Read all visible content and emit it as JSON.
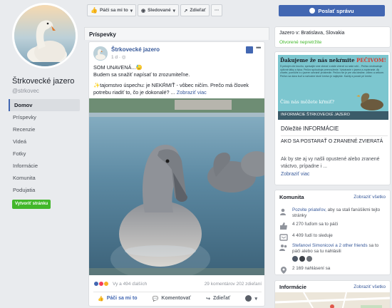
{
  "page": {
    "name": "Štrkovecké jazero",
    "handle": "@strkovec"
  },
  "left_nav": {
    "items": [
      "Domov",
      "Príspevky",
      "Recenzie",
      "Videá",
      "Fotky",
      "Informácie",
      "Komunita",
      "Podujatia"
    ],
    "create_store": "Vytvoriť stránku"
  },
  "topbar": {
    "like": "Páči sa mi to",
    "follow": "Sledované",
    "share": "Zdieľať",
    "more": "···",
    "send_message": "Poslať správu"
  },
  "posts": {
    "header": "Príspevky"
  },
  "post": {
    "author": "Štrkovecké jazero",
    "time": "1 d",
    "text_line1": "SOM UNAVENÁ...😓",
    "text_line2": "Budem sa snažiť napísať to zrozumiteľne.",
    "text_line3": "✨tajomstvo úspechu: je NEKŔMIŤ - vôbec ničím. Prečo má človek potrebu riadiť to, čo je dokonalé? ...",
    "see_more": "Zobraziť viac",
    "reaction_count": "Vy a 494 ďalších",
    "reaction_stats": "29 komentárov  202 zdieľaní",
    "actions": [
      "Páči sa mi to",
      "Komentovať",
      "Zdieľať"
    ]
  },
  "about": {
    "location": "Jazero v: Bratislava, Slovakia",
    "open": "Otvorené nepretržite"
  },
  "info_card": {
    "banner_title_prefix": "Ďakujeme že nás nekŕmite",
    "banner_title_emph": "PEČIVOM!",
    "banner_text": "S pekným dní kruchu, správajte sme zberať a stále zberať sú naše srbi... Pečivo neobsahuje výživné látky a býva. Pečivo spôsobuje premnoženie. Vytváranie v jazera a zopieranie. Ak chcete, pomôžte a v jazere ochrániť prostredie. Pečivo nie je pre vás ideálne, vôbec a celkom. Pečivo sa dáva buď a rozhodne ktoré krmivo je najlepšie. Každý a poradí pri krmiví.",
    "banner_question": "Čím nás môžete kŕmiť?",
    "banner_caption": "INFORMÁCIE ŠTRKOVECKÉ JAZERO",
    "title": "Dôležité INFORMÁCIE",
    "heading": "AKO SA POSTARAŤ O ZRANENÉ ZVIERATÁ",
    "body": "Ak by ste aj vy našli opustené alebo zranené vtáctvo, prípadne i ...",
    "more": "Zobraziť viac"
  },
  "community": {
    "header": "Komunita",
    "see_all": "Zobraziť všetko",
    "invite_link": "Pozvite priateľov,",
    "invite_rest": "aby sa stali fanúšikmi tejto stránky",
    "likes": "4 270 ľuďom sa to páči",
    "follows": "4 409 ľudí to sleduje",
    "friends_link": "Stefanovi Simonicovi a 2 other friends",
    "friends_rest": "sa to páči alebo sa tu nahlásili",
    "checkins": "2 169 nahlásení sa"
  },
  "info2": {
    "header": "Informácie",
    "see_all": "Zobraziť všetko"
  },
  "colors": {
    "brand": "#4267b2",
    "link": "#365899",
    "green": "#42b72a",
    "background": "#e9ebee"
  }
}
